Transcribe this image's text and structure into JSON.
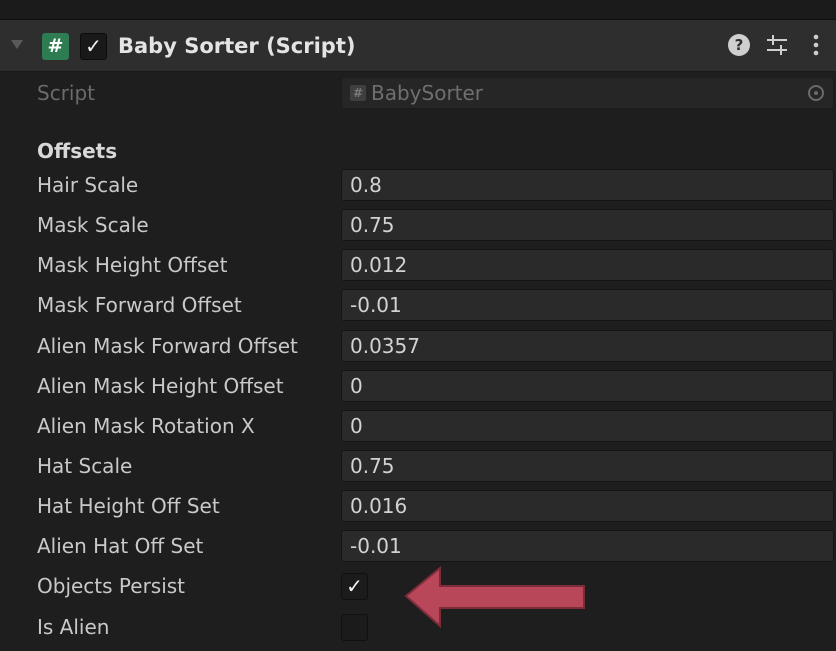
{
  "component": {
    "title": "Baby Sorter (Script)",
    "script_icon_glyph": "#",
    "enabled_glyph": "✓",
    "enabled": true,
    "help_glyph": "?",
    "icons": {
      "script": "csharp-script-icon",
      "help": "help-icon",
      "presets": "sliders-icon",
      "menu": "kebab-menu-icon"
    },
    "colors": {
      "panel_bg": "#1e1e1e",
      "header_bg": "#2e2e2e",
      "field_bg": "#2a2a2a",
      "script_icon": "#2e7d52",
      "arrow": "#b8475a"
    }
  },
  "script_row": {
    "label": "Script",
    "value": "BabySorter",
    "icon_glyph": "#"
  },
  "section": {
    "label": "Offsets"
  },
  "fields": [
    {
      "label": "Hair Scale",
      "value": "0.8"
    },
    {
      "label": "Mask Scale",
      "value": "0.75"
    },
    {
      "label": "Mask Height Offset",
      "value": "0.012"
    },
    {
      "label": "Mask Forward Offset",
      "value": "-0.01"
    },
    {
      "label": "Alien Mask Forward Offset",
      "value": "0.0357"
    },
    {
      "label": "Alien Mask Height Offset",
      "value": "0"
    },
    {
      "label": "Alien Mask Rotation X",
      "value": "0"
    },
    {
      "label": "Hat Scale",
      "value": "0.75"
    },
    {
      "label": "Hat Height Off Set",
      "value": "0.016"
    },
    {
      "label": "Alien Hat Off Set",
      "value": "-0.01"
    }
  ],
  "toggles": [
    {
      "label": "Objects Persist",
      "checked": true,
      "glyph": "✓"
    },
    {
      "label": "Is Alien",
      "checked": false,
      "glyph": ""
    }
  ]
}
